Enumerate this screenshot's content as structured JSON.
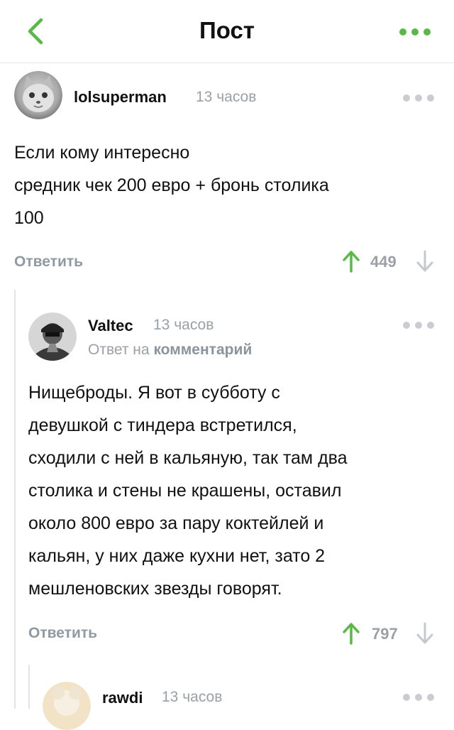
{
  "header": {
    "title": "Пост",
    "back_icon": "chevron-left-icon",
    "more_icon": "more-dots-icon",
    "accent_color": "#59b947"
  },
  "comments": [
    {
      "author": "lolsuperman",
      "time": "13 часов",
      "avatar_icon": "cat-avatar",
      "text": "Если кому интересно\nсредник чек 200 евро + бронь столика\n100",
      "reply_label": "Ответить",
      "rating": "449"
    },
    {
      "author": "Valtec",
      "time": "13 часов",
      "avatar_icon": "person-avatar",
      "reply_prefix": "Ответ на",
      "reply_link": "комментарий",
      "text": "Нищеброды. Я вот в субботу с\nдевушкой с тиндера встретился,\nсходили с ней в кальяную, так там два\nстолика и стены не крашены, оставил\nоколо 800 евро за пару коктейлей и\nкальян, у них даже кухни нет, зато 2\nмешленовских звезды говорят.",
      "reply_label": "Ответить",
      "rating": "797"
    },
    {
      "author": "rawdi",
      "time": "13 часов",
      "avatar_icon": "emoji-avatar"
    }
  ]
}
